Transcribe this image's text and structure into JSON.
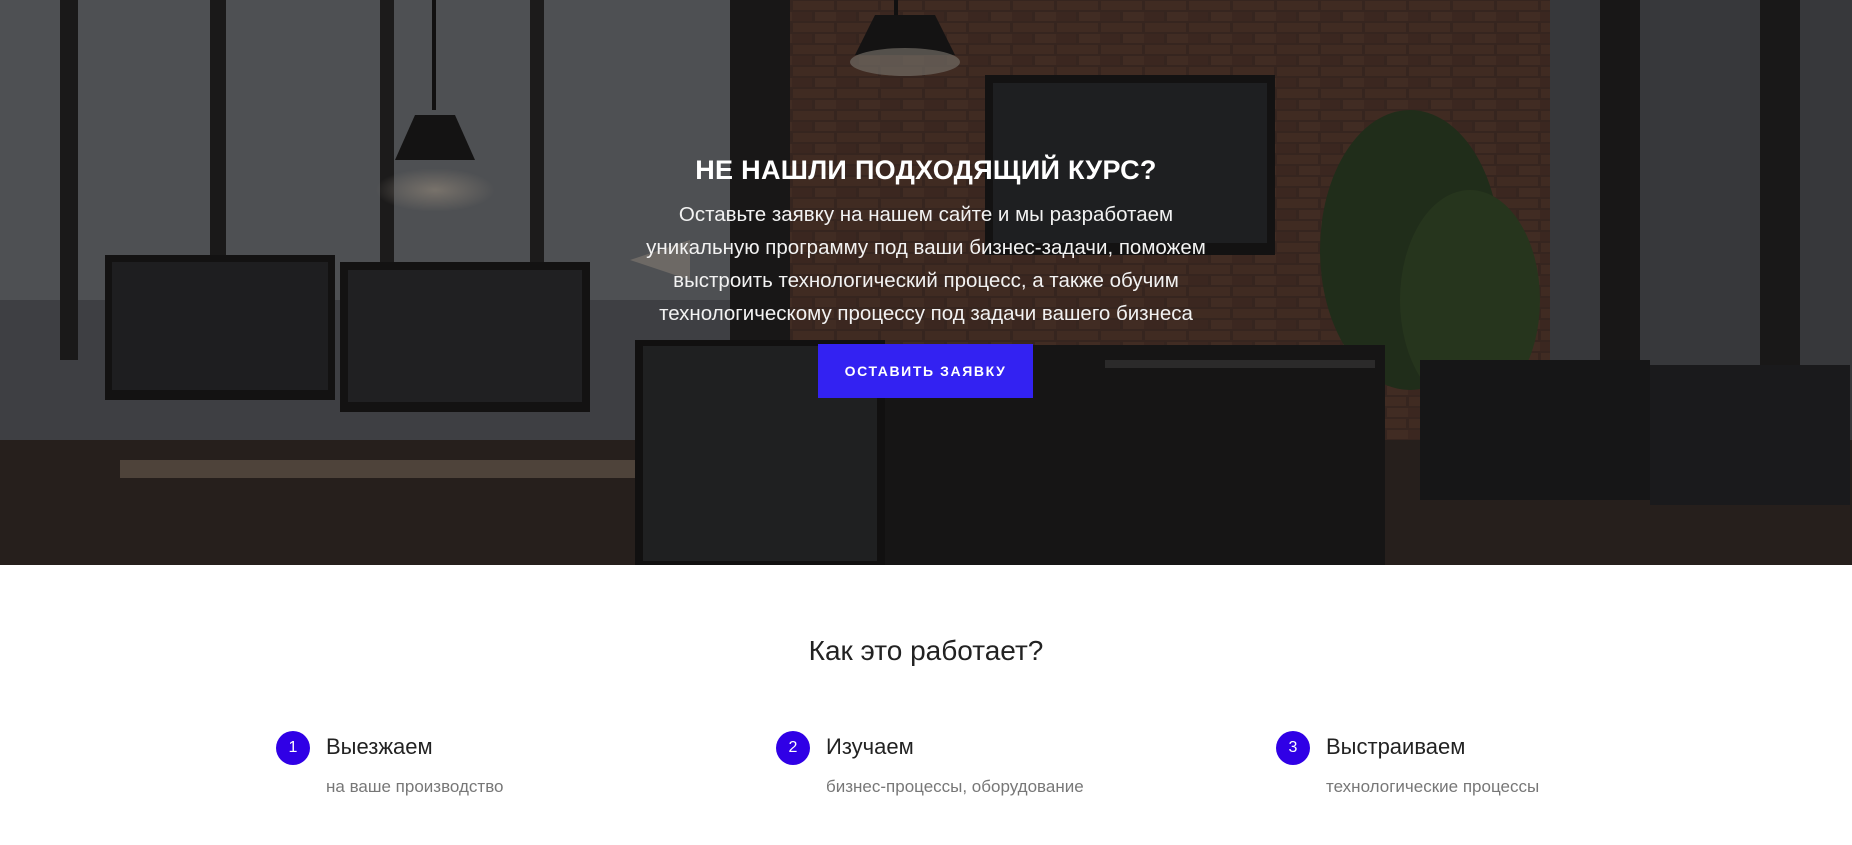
{
  "hero": {
    "title": "НЕ НАШЛИ ПОДХОДЯЩИЙ КУРС?",
    "text": "Оставьте заявку на нашем сайте и мы разработаем уникальную программу под ваши бизнес-задачи, поможем выстроить технологический процесс, а также обучим технологическому процессу под задачи вашего бизнеса",
    "cta_label": "ОСТАВИТЬ ЗАЯВКУ",
    "background": "office-with-monitors-photo"
  },
  "how": {
    "title": "Как это работает?",
    "steps": [
      {
        "number": "1",
        "title": "Выезжаем",
        "description": "на ваше производство"
      },
      {
        "number": "2",
        "title": "Изучаем",
        "description": "бизнес-процессы, оборудование"
      },
      {
        "number": "3",
        "title": "Выстраиваем",
        "description": "технологические процессы"
      }
    ]
  },
  "colors": {
    "accent_button": "#3322f2",
    "step_badge": "#3000e6"
  }
}
